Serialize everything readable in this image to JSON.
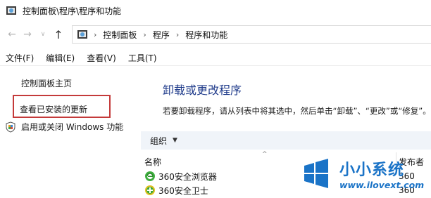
{
  "window": {
    "title": "控制面板\\程序\\程序和功能"
  },
  "navigation": {
    "back_icon": "arrow-left-icon",
    "forward_icon": "arrow-right-icon",
    "up_icon": "arrow-up-icon",
    "breadcrumbs": [
      "控制面板",
      "程序",
      "程序和功能"
    ]
  },
  "menu": {
    "items": [
      "文件(F)",
      "编辑(E)",
      "查看(V)",
      "工具(T)"
    ]
  },
  "sidebar": {
    "home_link": "控制面板主页",
    "updates_link": "查看已安装的更新",
    "features_link": "启用或关闭 Windows 功能",
    "highlight_color": "#c43a3a"
  },
  "main": {
    "title": "卸载或更改程序",
    "description": "若要卸载程序，请从列表中将其选中，然后单击“卸载”、“更改”或“修复”。",
    "toolbar": {
      "organize": "组织"
    },
    "columns": {
      "name": "名称",
      "publisher": "发布者"
    },
    "programs": [
      {
        "name": "360安全浏览器",
        "publisher": "360",
        "icon": "browser-360-icon"
      },
      {
        "name": "360安全卫士",
        "publisher": "360",
        "icon": "guard-360-icon"
      }
    ]
  },
  "watermark": {
    "text": "小小系统",
    "url": "www.ilovext.com",
    "color": "#1a73c7"
  }
}
